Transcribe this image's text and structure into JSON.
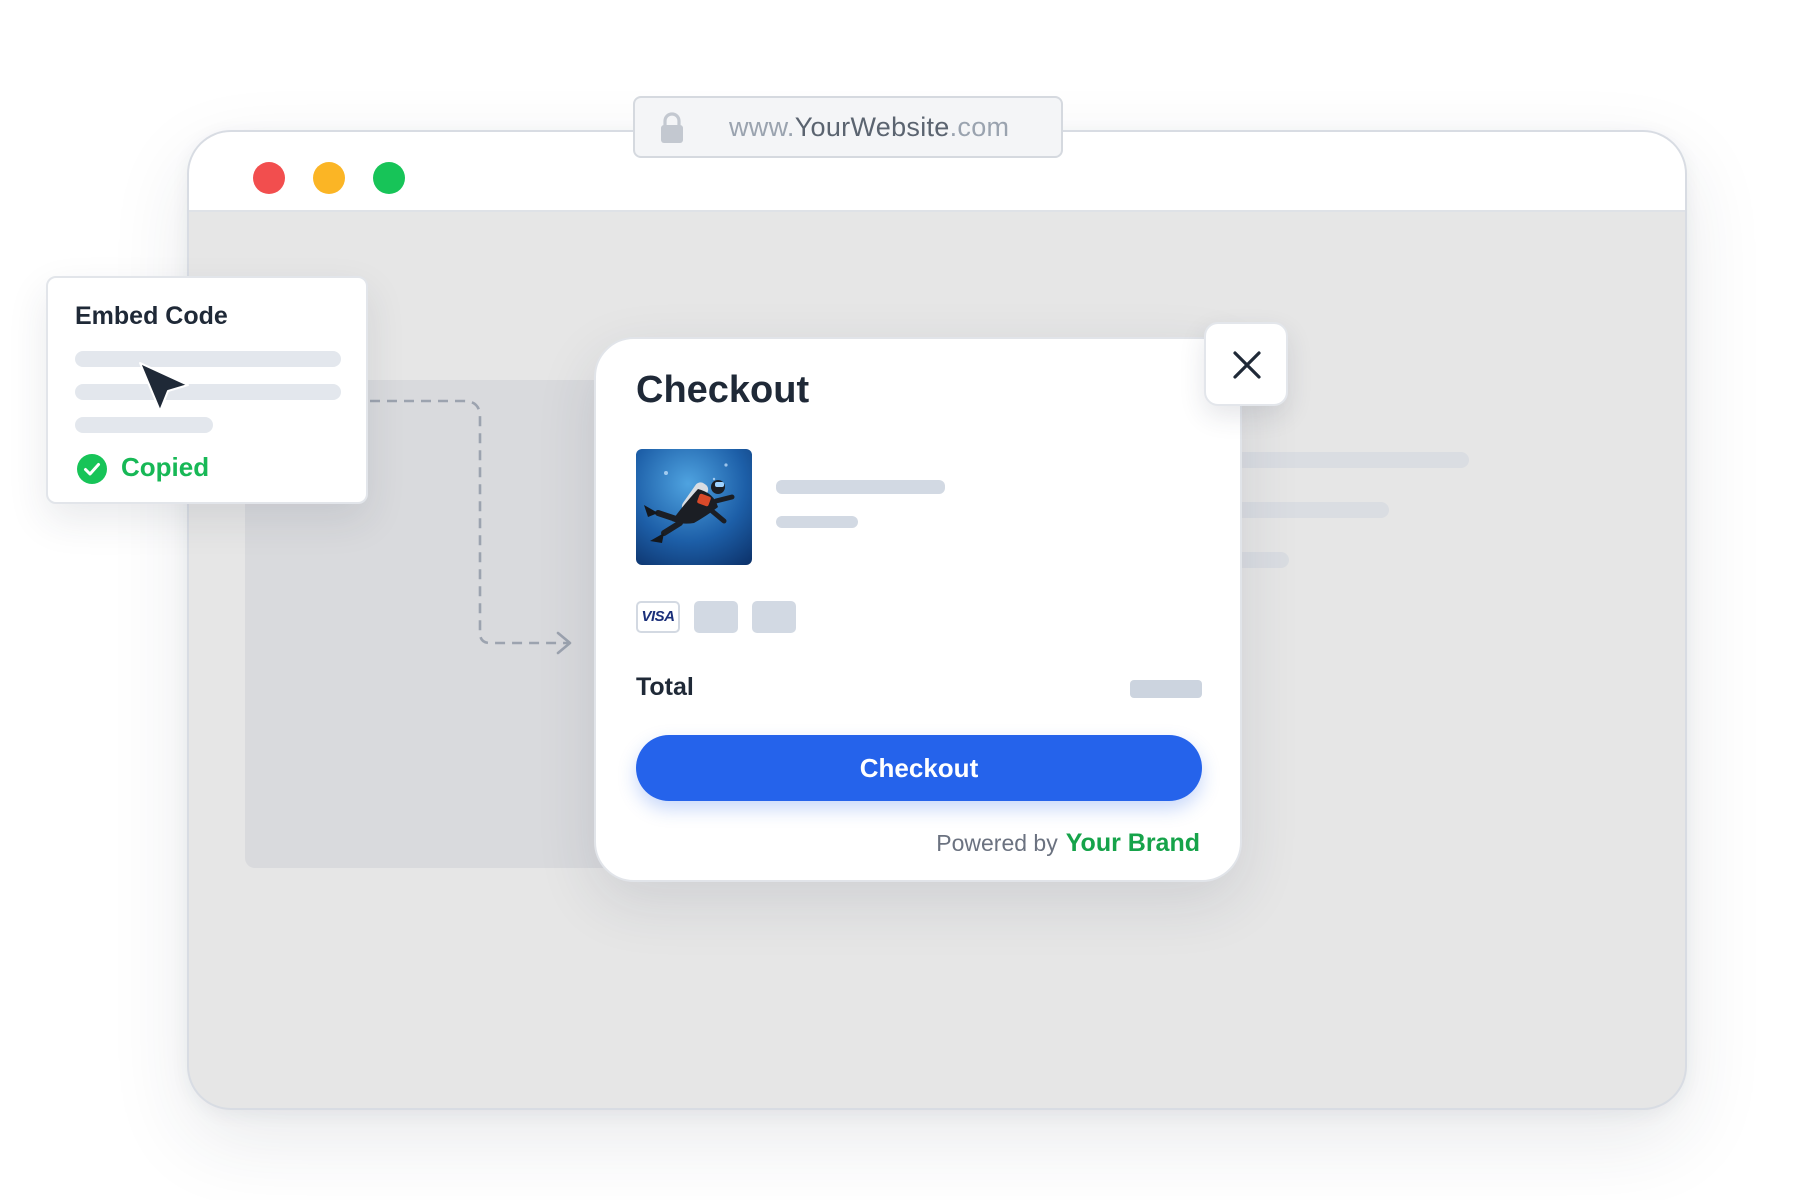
{
  "browser": {
    "url_prefix": "www.",
    "url_domain": "YourWebsite",
    "url_suffix": ".com",
    "window_controls": [
      "close-dot",
      "minimize-dot",
      "maximize-dot"
    ]
  },
  "embed_card": {
    "title": "Embed Code",
    "status": "Copied"
  },
  "checkout": {
    "title": "Checkout",
    "product_image_alt": "scuba-diver-photo",
    "payment_methods": [
      "VISA",
      "",
      ""
    ],
    "total_label": "Total",
    "button_label": "Checkout",
    "powered_by": "Powered by",
    "brand": "Your Brand"
  },
  "colors": {
    "primary": "#2563eb",
    "brand_green": "#16a34a",
    "copied_green": "#17b856",
    "dot_red": "#f24e4e",
    "dot_yellow": "#fbb525",
    "dot_green": "#17c458"
  },
  "icons": [
    "lock-icon",
    "cursor-arrow-icon",
    "check-circle-icon",
    "close-icon",
    "visa-card-icon"
  ]
}
